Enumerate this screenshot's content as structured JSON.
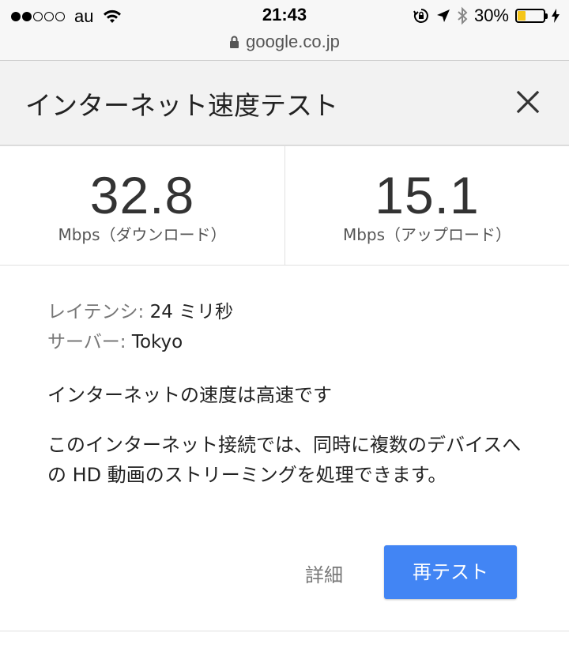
{
  "status_bar": {
    "carrier": "au",
    "time": "21:43",
    "battery_percent": "30%",
    "battery_level": 0.3,
    "signal_bars": 2,
    "signal_total": 5
  },
  "url_bar": {
    "url": "google.co.jp"
  },
  "header": {
    "title": "インターネット速度テスト"
  },
  "download": {
    "value": "32.8",
    "label": "Mbps（ダウンロード）"
  },
  "upload": {
    "value": "15.1",
    "label": "Mbps（アップロード）"
  },
  "details": {
    "latency_label": "レイテンシ:",
    "latency_value": "24 ミリ秒",
    "server_label": "サーバー:",
    "server_value": "Tokyo"
  },
  "summary": "インターネットの速度は高速です",
  "description": "このインターネット接続では、同時に複数のデバイスへの HD 動画のストリーミングを処理できます。",
  "actions": {
    "details_label": "詳細",
    "retest_label": "再テスト"
  },
  "colors": {
    "primary_button": "#4285f4",
    "battery_fill": "#f5c518"
  }
}
